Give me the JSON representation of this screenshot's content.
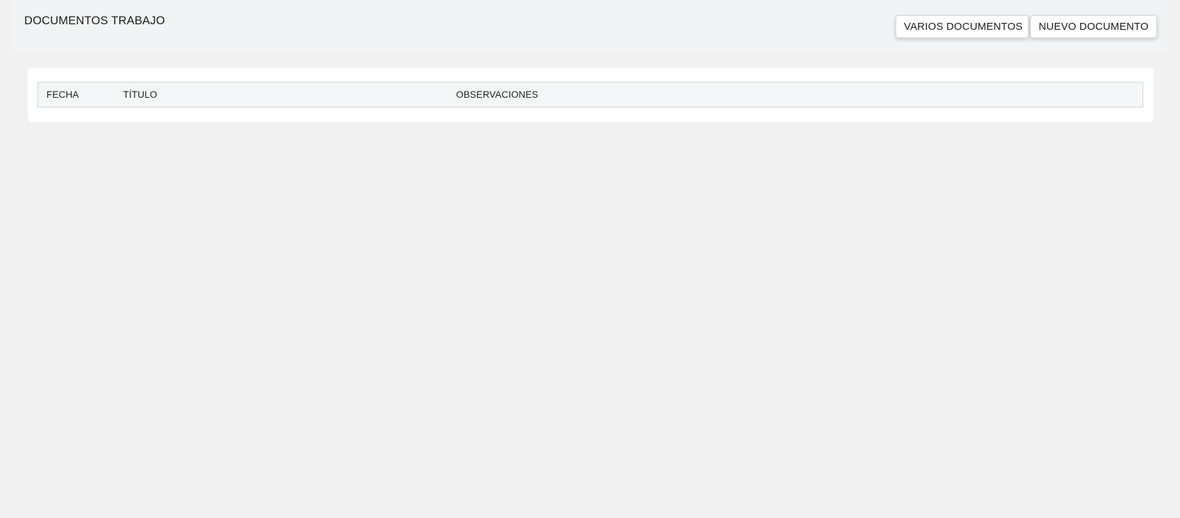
{
  "header": {
    "title": "DOCUMENTOS TRABAJO",
    "buttons": {
      "varios_label": "VARIOS DOCUMENTOS",
      "nuevo_label": "NUEVO DOCUMENTO"
    }
  },
  "table": {
    "columns": [
      "FECHA",
      "TÍTULO",
      "OBSERVACIONES"
    ],
    "rows": []
  },
  "colors": {
    "page_background": "#f0f1f0",
    "header_background": "#f1f3f4",
    "card_background": "#ffffff",
    "table_header_background": "#f5f6f8"
  }
}
